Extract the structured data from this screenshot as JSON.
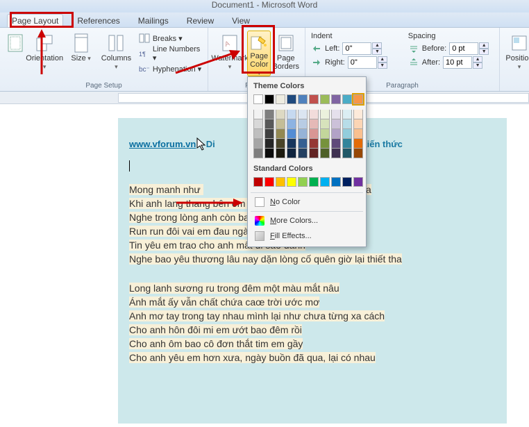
{
  "title": "Document1 - Microsoft Word",
  "tabs": {
    "page_layout": "Page Layout",
    "references": "References",
    "mailings": "Mailings",
    "review": "Review",
    "view": "View"
  },
  "ribbon": {
    "page_setup": {
      "orientation": "Orientation",
      "size": "Size",
      "columns": "Columns",
      "breaks": "Breaks",
      "line_numbers": "Line Numbers",
      "hyphenation": "Hyphenation",
      "group_label": "Page Setup"
    },
    "page_background": {
      "watermark": "Watermark",
      "page_color": "Page\nColor",
      "page_borders": "Page\nBorders",
      "group_label": "Page B"
    },
    "paragraph": {
      "indent_label": "Indent",
      "left_label": "Left:",
      "left_value": "0\"",
      "right_label": "Right:",
      "right_value": "0\"",
      "spacing_label": "Spacing",
      "before_label": "Before:",
      "before_value": "0 pt",
      "after_label": "After:",
      "after_value": "10 pt",
      "group_label": "Paragraph"
    },
    "arrange": {
      "position": "Position"
    }
  },
  "dropdown": {
    "theme_colors_label": "Theme Colors",
    "standard_colors_label": "Standard Colors",
    "no_color": "o Color",
    "no_color_prefix": "N",
    "more_colors": "ore Colors...",
    "more_colors_prefix": "M",
    "fill_effects": "ill Effects...",
    "fill_effects_prefix": "F",
    "theme_row1": [
      "#ffffff",
      "#000000",
      "#eeece1",
      "#1f497d",
      "#4f81bd",
      "#c0504d",
      "#9bbb59",
      "#8064a2",
      "#4bacc6",
      "#f79646"
    ],
    "theme_shades": [
      [
        "#f2f2f2",
        "#7f7f7f",
        "#ddd9c3",
        "#c6d9f0",
        "#dbe5f1",
        "#f2dcdb",
        "#ebf1dd",
        "#e5e0ec",
        "#dbeef3",
        "#fdeada"
      ],
      [
        "#d8d8d8",
        "#595959",
        "#c4bd97",
        "#8db3e2",
        "#b8cce4",
        "#e5b9b7",
        "#d7e3bc",
        "#ccc1d9",
        "#b7dde8",
        "#fbd5b5"
      ],
      [
        "#bfbfbf",
        "#3f3f3f",
        "#938953",
        "#548dd4",
        "#95b3d7",
        "#d99694",
        "#c3d69b",
        "#b2a2c7",
        "#92cddc",
        "#fac08f"
      ],
      [
        "#a5a5a5",
        "#262626",
        "#494429",
        "#17365d",
        "#366092",
        "#953734",
        "#76923c",
        "#5f497a",
        "#31859b",
        "#e36c09"
      ],
      [
        "#7f7f7f",
        "#0c0c0c",
        "#1d1b10",
        "#0f243e",
        "#244061",
        "#632423",
        "#4f6128",
        "#3f3151",
        "#205867",
        "#974806"
      ]
    ],
    "standard_colors": [
      "#c00000",
      "#ff0000",
      "#ffc000",
      "#ffff00",
      "#92d050",
      "#00b050",
      "#00b0f0",
      "#0070c0",
      "#002060",
      "#7030a0"
    ]
  },
  "document": {
    "link_text": "www.vforum.vn",
    "link_rest": " – Di",
    "link_tail": "ia sẻ kiến thức",
    "lines_a": [
      "Mong manh như ",
      "Khi anh lang thang bên em đường chiều nắng xa",
      "Nghe trong lòng anh còn bao lời cám ơn, lời xin lỗi",
      "Run run đôi vai em đau ngày nào bước đi",
      "Tin yêu em trao cho anh mất đi sao đành",
      "Nghe bao yêu thương lâu nay dặn lòng cố quên giờ lại thiết tha"
    ],
    "line_a0_tail": "hoáng qua",
    "lines_b": [
      "Long lanh sương ru trong đêm một màu mắt nâu",
      "Ánh mắt ấy vẫn chất chứa caœ trời ước mơ",
      "Anh mơ tay trong tay nhau mình lại như chưa từng xa cách",
      "Cho anh hôn đôi mi em ướt bao đêm rồi",
      "Cho anh ôm bao cô đơn thắt tim em gầy",
      "Cho anh yêu em hơn xưa, ngày buồn đã qua, lại có nhau"
    ]
  }
}
